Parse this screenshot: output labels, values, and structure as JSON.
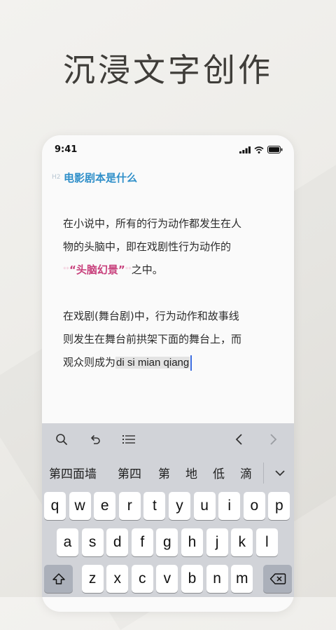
{
  "headline": "沉浸文字创作",
  "status_bar": {
    "time": "9:41"
  },
  "document": {
    "heading_tag": "H2",
    "heading": "电影剧本是什么",
    "para1_line1": "在小说中，所有的行为动作都发生在人",
    "para1_line2": "物的头脑中，即在戏剧性行为动作的",
    "para1_mark_open": "**",
    "para1_highlight": "“头脑幻景”",
    "para1_mark_close": "**",
    "para1_tail": "之中。",
    "para2_line1": "在戏剧(舞台剧)中，行为动作和故事线",
    "para2_line2": "则发生在舞台前拱架下面的舞台上，而",
    "para2_line3": "观众则成为",
    "composing_text": "di si mian qiang"
  },
  "toolbar": {
    "icons": [
      "search-icon",
      "undo-icon",
      "list-icon",
      "chevron-left-icon",
      "chevron-right-icon"
    ]
  },
  "candidates": [
    "第四面墙",
    "第四",
    "第",
    "地",
    "低",
    "滴"
  ],
  "keyboard": {
    "row1": [
      "q",
      "w",
      "e",
      "r",
      "t",
      "y",
      "u",
      "i",
      "o",
      "p"
    ],
    "row2": [
      "a",
      "s",
      "d",
      "f",
      "g",
      "h",
      "j",
      "k",
      "l"
    ],
    "row3": [
      "z",
      "x",
      "c",
      "v",
      "b",
      "n",
      "m"
    ]
  },
  "colors": {
    "heading": "#2f8fc9",
    "highlight": "#c8407c",
    "caret": "#3d6de0"
  }
}
